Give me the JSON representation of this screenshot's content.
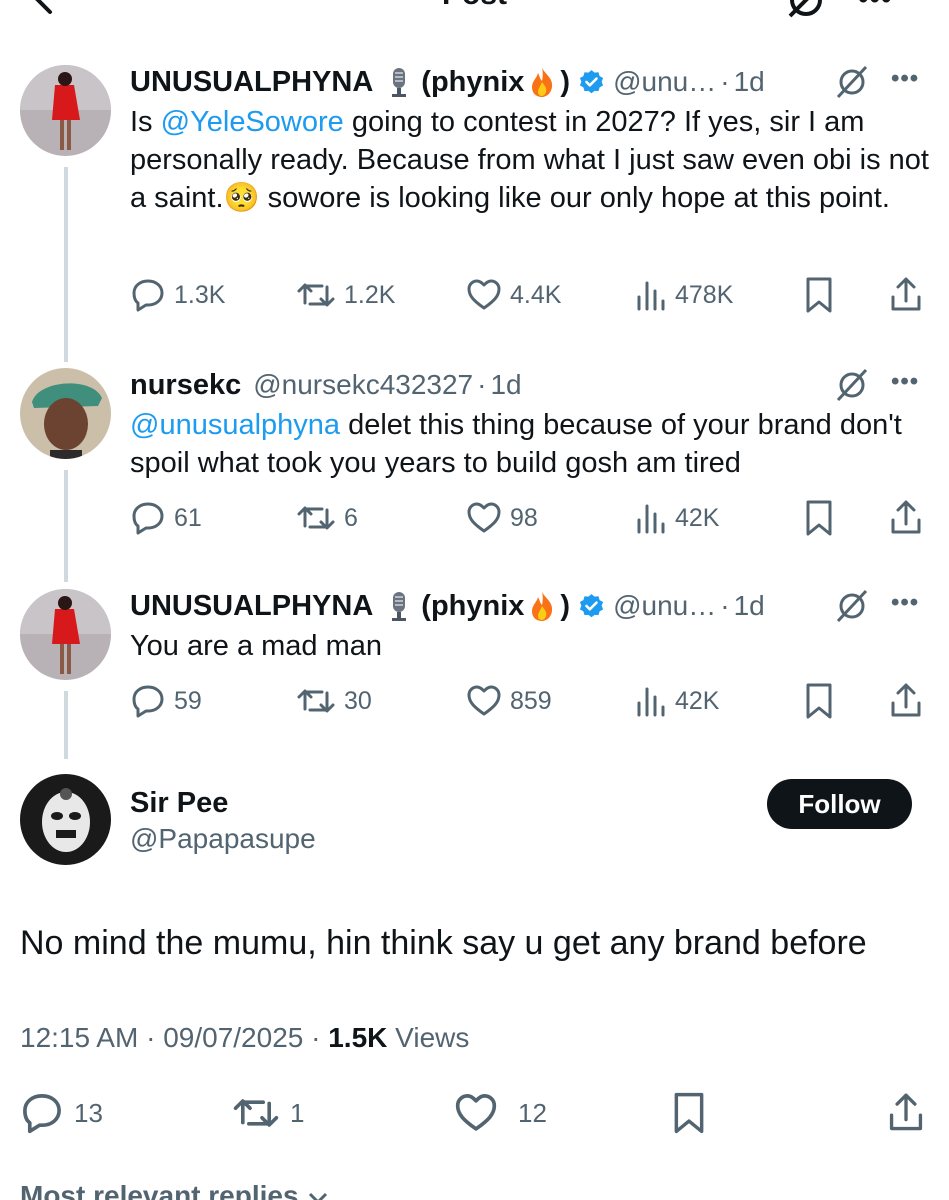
{
  "header": {
    "title": "Post",
    "back_icon": "arrow-left-icon",
    "grok_icon": "grok-icon",
    "more_icon": "more-horizontal-icon"
  },
  "thread": [
    {
      "name": "UNUSUALPHYNA",
      "name_suffix_open": "(phynix",
      "name_suffix_close": ")",
      "verified": true,
      "handle": "@unu…",
      "time": "1d",
      "text_parts": [
        {
          "t": "Is ",
          "mention": false
        },
        {
          "t": "@YeleSowore",
          "mention": true
        },
        {
          "t": " going to contest in 2027? If yes, sir I am personally ready. Because from what I just saw even obi is not a saint.",
          "mention": false
        },
        {
          "t": "🥺",
          "mention": false
        },
        {
          "t": " sowore is looking like our only hope at this point.",
          "mention": false
        }
      ],
      "stats": {
        "replies": "1.3K",
        "reposts": "1.2K",
        "likes": "4.4K",
        "views": "478K"
      }
    },
    {
      "name": "nursekc",
      "handle": "@nursekc432327",
      "time": "1d",
      "text_parts": [
        {
          "t": "@unusualphyna",
          "mention": true
        },
        {
          "t": " delet this thing because of your brand don't spoil what took you years to build gosh am tired",
          "mention": false
        }
      ],
      "stats": {
        "replies": "61",
        "reposts": "6",
        "likes": "98",
        "views": "42K"
      }
    },
    {
      "name": "UNUSUALPHYNA",
      "name_suffix_open": "(phynix",
      "name_suffix_close": ")",
      "verified": true,
      "handle": "@unu…",
      "time": "1d",
      "text_parts": [
        {
          "t": "You are a mad man",
          "mention": false
        }
      ],
      "stats": {
        "replies": "59",
        "reposts": "30",
        "likes": "859",
        "views": "42K"
      }
    }
  ],
  "main_post": {
    "name": "Sir Pee",
    "handle": "@Papapasupe",
    "follow_label": "Follow",
    "text": "No mind the mumu, hin think say u get any brand before",
    "time": "12:15 AM",
    "date": "09/07/2025",
    "views_count": "1.5K",
    "views_label": "Views",
    "stats": {
      "replies": "13",
      "reposts": "1",
      "likes": "12"
    }
  },
  "footer": {
    "most_relevant": "Most relevant replies"
  },
  "colors": {
    "mention": "#1d9bf0",
    "secondary": "#536471",
    "verified": "#1d9bf0",
    "thread_line": "#cfd9de"
  }
}
